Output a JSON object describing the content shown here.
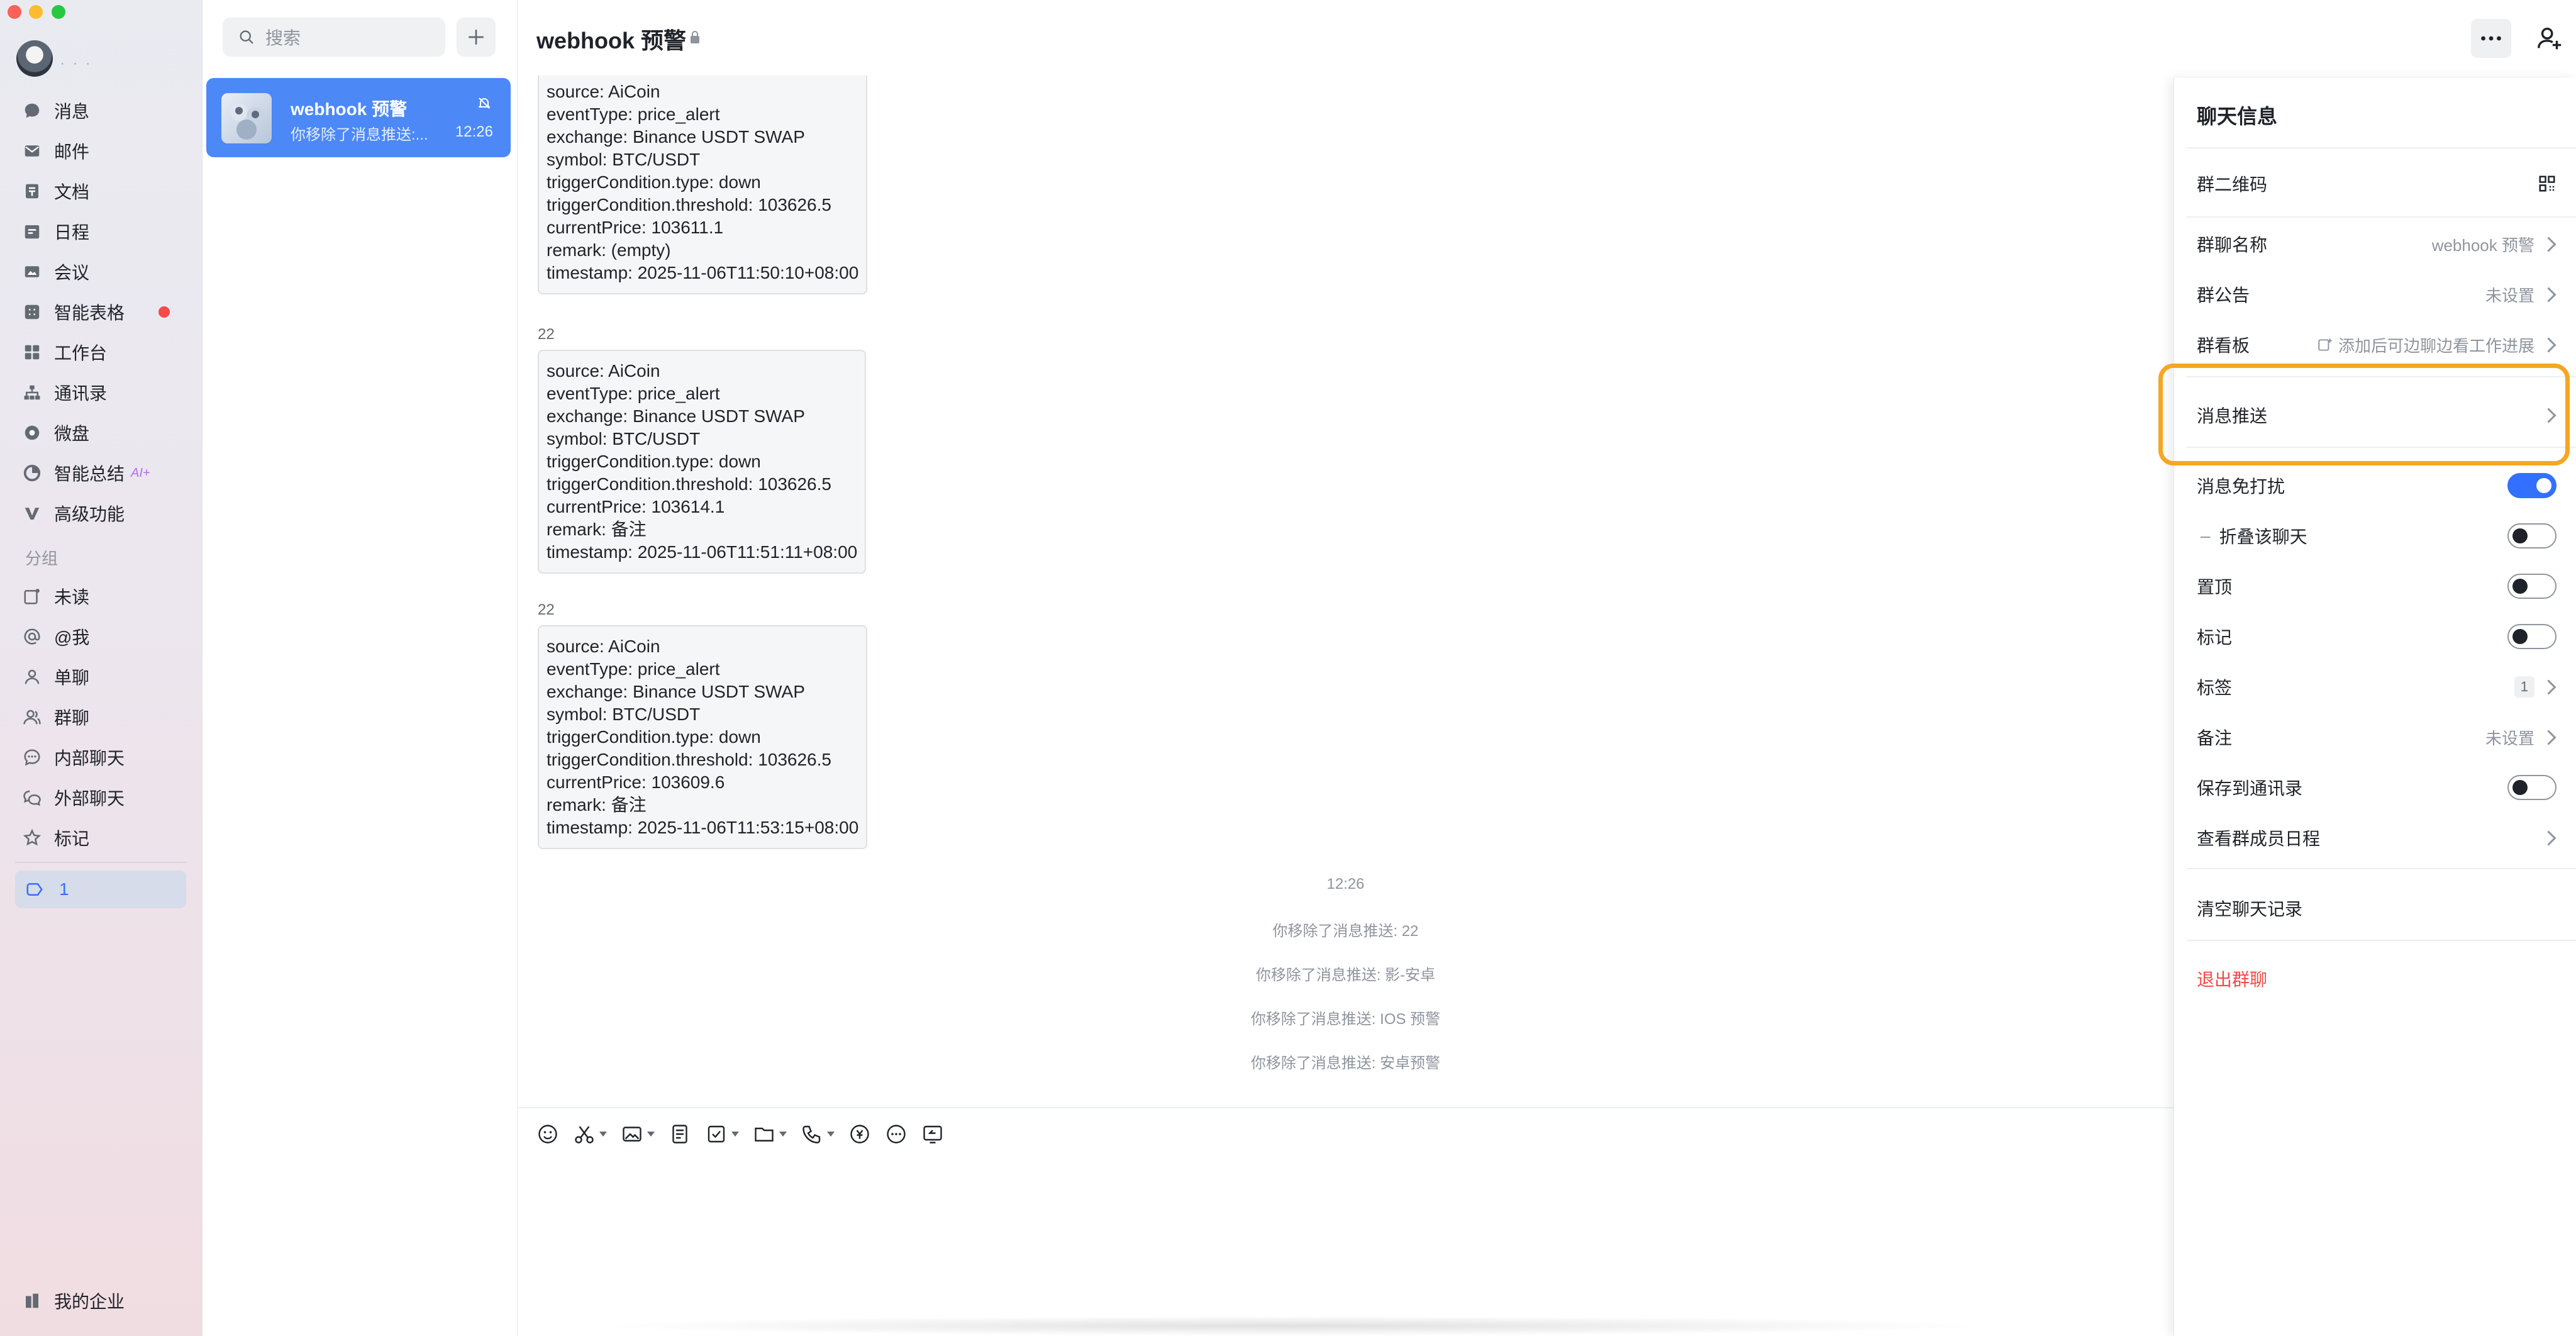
{
  "rail": {
    "items": [
      {
        "label": "消息",
        "icon": "chat-icon"
      },
      {
        "label": "邮件",
        "icon": "mail-icon"
      },
      {
        "label": "文档",
        "icon": "doc-icon"
      },
      {
        "label": "日程",
        "icon": "calendar-icon"
      },
      {
        "label": "会议",
        "icon": "meeting-icon"
      },
      {
        "label": "智能表格",
        "icon": "table-icon"
      },
      {
        "label": "工作台",
        "icon": "workbench-icon"
      },
      {
        "label": "通讯录",
        "icon": "contacts-icon"
      },
      {
        "label": "微盘",
        "icon": "drive-icon"
      },
      {
        "label": "智能总结",
        "icon": "summary-icon",
        "tag": "AI+"
      },
      {
        "label": "高级功能",
        "icon": "advanced-icon"
      }
    ],
    "group_label": "分组",
    "groups": [
      {
        "label": "未读",
        "icon": "unread-icon"
      },
      {
        "label": "@我",
        "icon": "at-icon"
      },
      {
        "label": "单聊",
        "icon": "person-icon"
      },
      {
        "label": "群聊",
        "icon": "group-icon"
      },
      {
        "label": "内部聊天",
        "icon": "internal-chat-icon"
      },
      {
        "label": "外部聊天",
        "icon": "external-chat-icon"
      },
      {
        "label": "标记",
        "icon": "star-icon"
      }
    ],
    "selected_tag": "1",
    "enterprise": "我的企业"
  },
  "convlist": {
    "search_placeholder": "搜索",
    "chat": {
      "title": "webhook 预警",
      "preview": "你移除了消息推送:...",
      "time": "12:26"
    }
  },
  "chat": {
    "title": "webhook 预警",
    "messages": [
      {
        "sender": "",
        "lines": [
          "source: AiCoin",
          "eventType: price_alert",
          "exchange: Binance USDT SWAP",
          "symbol: BTC/USDT",
          "triggerCondition.type: down",
          "triggerCondition.threshold: 103626.5",
          "currentPrice: 103611.1",
          "remark: (empty)",
          "timestamp: 2025-11-06T11:50:10+08:00"
        ]
      },
      {
        "sender": "22",
        "lines": [
          "source: AiCoin",
          "eventType: price_alert",
          "exchange: Binance USDT SWAP",
          "symbol: BTC/USDT",
          "triggerCondition.type: down",
          "triggerCondition.threshold: 103626.5",
          "currentPrice: 103614.1",
          "remark: 备注",
          "timestamp: 2025-11-06T11:51:11+08:00"
        ]
      },
      {
        "sender": "22",
        "lines": [
          "source: AiCoin",
          "eventType: price_alert",
          "exchange: Binance USDT SWAP",
          "symbol: BTC/USDT",
          "triggerCondition.type: down",
          "triggerCondition.threshold: 103626.5",
          "currentPrice: 103609.6",
          "remark: 备注",
          "timestamp: 2025-11-06T11:53:15+08:00"
        ]
      }
    ],
    "time_divider": "12:26",
    "system_messages": [
      "你移除了消息推送: 22",
      "你移除了消息推送: 影-安卓",
      "你移除了消息推送: IOS 预警",
      "你移除了消息推送: 安卓预警"
    ]
  },
  "info": {
    "title": "聊天信息",
    "qr_label": "群二维码",
    "name_label": "群聊名称",
    "name_value": "webhook 预警",
    "notice_label": "群公告",
    "notice_value": "未设置",
    "board_label": "群看板",
    "board_value": "添加后可边聊边看工作进展",
    "push_label": "消息推送",
    "dnd_label": "消息免打扰",
    "dnd_on": true,
    "fold_label": "折叠该聊天",
    "pin_label": "置顶",
    "mark_label": "标记",
    "tag_label": "标签",
    "tag_value": "1",
    "remark_label": "备注",
    "remark_value": "未设置",
    "save_label": "保存到通讯录",
    "schedule_label": "查看群成员日程",
    "clear_label": "清空聊天记录",
    "exit_label": "退出群聊"
  },
  "colors": {
    "accent": "#3370ff",
    "highlight": "#f5a623",
    "danger": "#f54a45"
  }
}
